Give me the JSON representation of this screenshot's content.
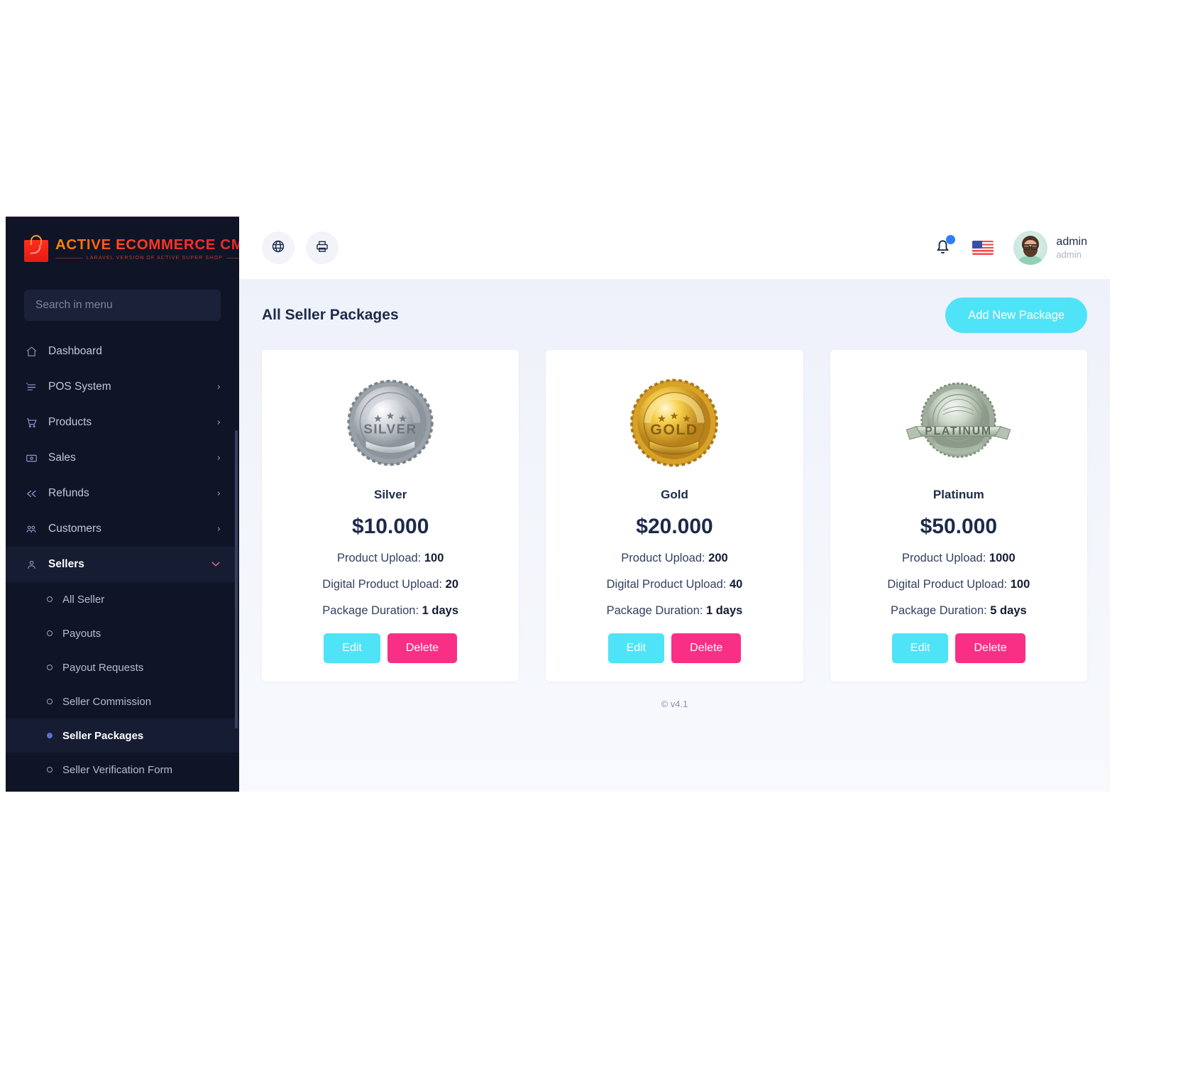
{
  "brand": {
    "title": "ACTIVE ECOMMERCE CMS",
    "subtitle": "LARAVEL VERSION OF ACTIVE SUPER SHOP",
    "logo_icon": "shopping-bag-icon"
  },
  "sidebar": {
    "search": {
      "placeholder": "Search in menu",
      "value": "",
      "icon": "search-icon"
    },
    "items": [
      {
        "label": "Dashboard",
        "icon": "home-icon",
        "caret": "",
        "active": false
      },
      {
        "label": "POS System",
        "icon": "pos-icon",
        "caret": "›",
        "active": false
      },
      {
        "label": "Products",
        "icon": "cart-icon",
        "caret": "›",
        "active": false
      },
      {
        "label": "Sales",
        "icon": "money-icon",
        "caret": "›",
        "active": false
      },
      {
        "label": "Refunds",
        "icon": "rewind-icon",
        "caret": "›",
        "active": false
      },
      {
        "label": "Customers",
        "icon": "users-icon",
        "caret": "›",
        "active": false
      },
      {
        "label": "Sellers",
        "icon": "user-icon",
        "caret": "⌄",
        "active": true
      }
    ],
    "submenu": [
      {
        "label": "All Seller",
        "active": false
      },
      {
        "label": "Payouts",
        "active": false
      },
      {
        "label": "Payout Requests",
        "active": false
      },
      {
        "label": "Seller Commission",
        "active": false
      },
      {
        "label": "Seller Packages",
        "active": true
      },
      {
        "label": "Seller Verification Form",
        "active": false
      }
    ]
  },
  "topbar": {
    "globe_icon": "globe-icon",
    "print_icon": "printer-icon",
    "bell_icon": "bell-icon",
    "flag_icon": "us-flag-icon",
    "user": {
      "name": "admin",
      "role": "admin",
      "avatar_icon": "avatar"
    }
  },
  "page": {
    "title": "All Seller Packages",
    "add_button": "Add New Package"
  },
  "packages": [
    {
      "name": "Silver",
      "badge_icon": "silver-medal-icon",
      "price": "$10.000",
      "product_upload_label": "Product Upload:",
      "product_upload_value": "100",
      "digital_upload_label": "Digital Product Upload:",
      "digital_upload_value": "20",
      "duration_label": "Package Duration:",
      "duration_value": "1 days",
      "edit_label": "Edit",
      "delete_label": "Delete"
    },
    {
      "name": "Gold",
      "badge_icon": "gold-medal-icon",
      "price": "$20.000",
      "product_upload_label": "Product Upload:",
      "product_upload_value": "200",
      "digital_upload_label": "Digital Product Upload:",
      "digital_upload_value": "40",
      "duration_label": "Package Duration:",
      "duration_value": "1 days",
      "edit_label": "Edit",
      "delete_label": "Delete"
    },
    {
      "name": "Platinum",
      "badge_icon": "platinum-badge-icon",
      "price": "$50.000",
      "product_upload_label": "Product Upload:",
      "product_upload_value": "1000",
      "digital_upload_label": "Digital Product Upload:",
      "digital_upload_value": "100",
      "duration_label": "Package Duration:",
      "duration_value": "5 days",
      "edit_label": "Edit",
      "delete_label": "Delete"
    }
  ],
  "footer": {
    "text": "© v4.1"
  },
  "colors": {
    "accent_cyan": "#4fe3f7",
    "accent_pink": "#f92f86",
    "sidebar_bg": "#101427",
    "brand_orange": "#ff5a1f"
  }
}
